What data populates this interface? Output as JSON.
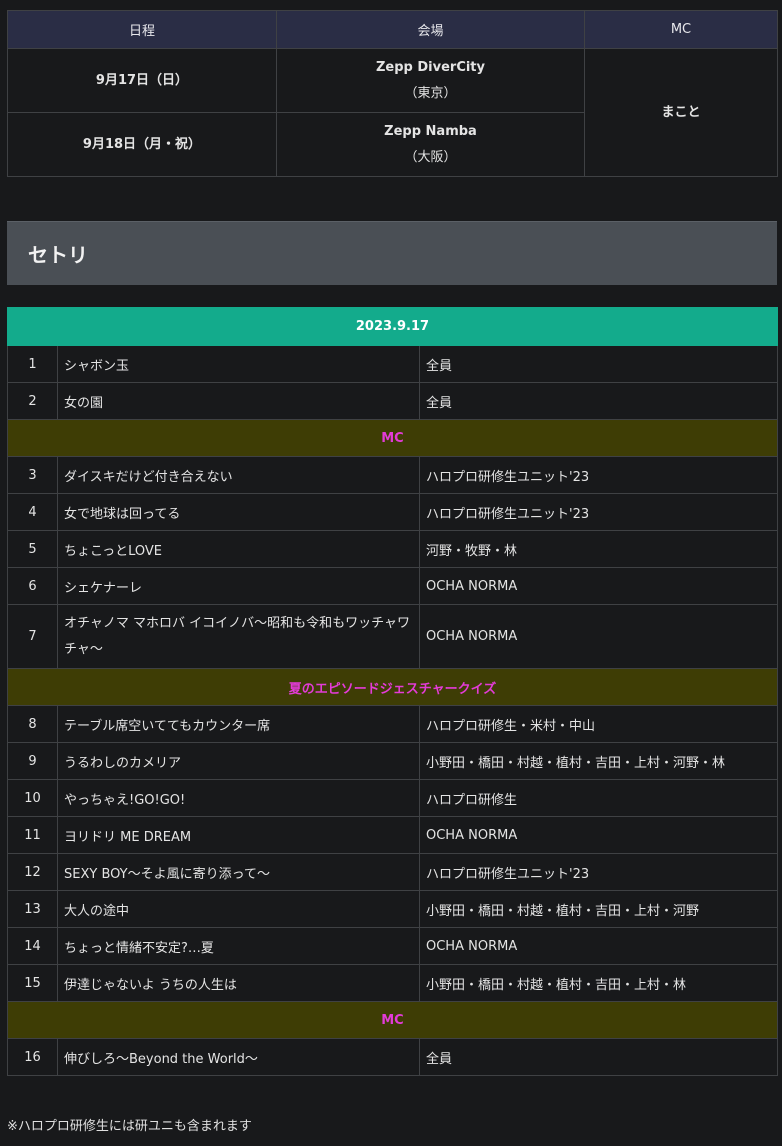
{
  "schedule": {
    "headers": [
      "日程",
      "会場",
      "MC"
    ],
    "rows": [
      {
        "date": "9月17日（日）",
        "venue": "Zepp DiverCity",
        "city": "（東京）"
      },
      {
        "date": "9月18日（月・祝）",
        "venue": "Zepp Namba",
        "city": "（大阪）"
      }
    ],
    "mc": "まこと"
  },
  "section_title": "セトリ",
  "setlist": {
    "date": "2023.9.17",
    "items": [
      {
        "type": "song",
        "num": "1",
        "title": "シャボン玉",
        "artist": "全員"
      },
      {
        "type": "song",
        "num": "2",
        "title": "女の園",
        "artist": "全員"
      },
      {
        "type": "break",
        "label": "MC"
      },
      {
        "type": "song",
        "num": "3",
        "title": "ダイスキだけど付き合えない",
        "artist": "ハロプロ研修生ユニット'23"
      },
      {
        "type": "song",
        "num": "4",
        "title": "女で地球は回ってる",
        "artist": "ハロプロ研修生ユニット'23"
      },
      {
        "type": "song",
        "num": "5",
        "title": "ちょこっとLOVE",
        "artist": "河野・牧野・林"
      },
      {
        "type": "song",
        "num": "6",
        "title": "シェケナーレ",
        "artist": "OCHA NORMA"
      },
      {
        "type": "song",
        "num": "7",
        "title": "オチャノマ マホロバ イコイノバ〜昭和も令和もワッチャワチャ〜",
        "artist": "OCHA NORMA",
        "tall": true
      },
      {
        "type": "break",
        "label": "夏のエピソードジェスチャークイズ"
      },
      {
        "type": "song",
        "num": "8",
        "title": "テーブル席空いててもカウンター席",
        "artist": "ハロプロ研修生・米村・中山"
      },
      {
        "type": "song",
        "num": "9",
        "title": "うるわしのカメリア",
        "artist": "小野田・橋田・村越・植村・吉田・上村・河野・林"
      },
      {
        "type": "song",
        "num": "10",
        "title": "やっちゃえ!GO!GO!",
        "artist": "ハロプロ研修生"
      },
      {
        "type": "song",
        "num": "11",
        "title": "ヨリドリ ME DREAM",
        "artist": "OCHA NORMA"
      },
      {
        "type": "song",
        "num": "12",
        "title": "SEXY BOY〜そよ風に寄り添って〜",
        "artist": "ハロプロ研修生ユニット'23"
      },
      {
        "type": "song",
        "num": "13",
        "title": "大人の途中",
        "artist": "小野田・橋田・村越・植村・吉田・上村・河野"
      },
      {
        "type": "song",
        "num": "14",
        "title": "ちょっと情緒不安定?…夏",
        "artist": "OCHA NORMA"
      },
      {
        "type": "song",
        "num": "15",
        "title": "伊達じゃないよ うちの人生は",
        "artist": "小野田・橋田・村越・植村・吉田・上村・林"
      },
      {
        "type": "break",
        "label": "MC"
      },
      {
        "type": "song",
        "num": "16",
        "title": "伸びしろ〜Beyond the World〜",
        "artist": "全員"
      }
    ]
  },
  "footnote": "※ハロプロ研修生には研ユニも含まれます",
  "colors": {
    "background": "#18191b",
    "schedule_header": "#2a2d45",
    "section_heading": "#4a4f55",
    "date_row": "#13ab8c",
    "break_row": "#3e3d05",
    "break_text": "#e33bd7"
  }
}
